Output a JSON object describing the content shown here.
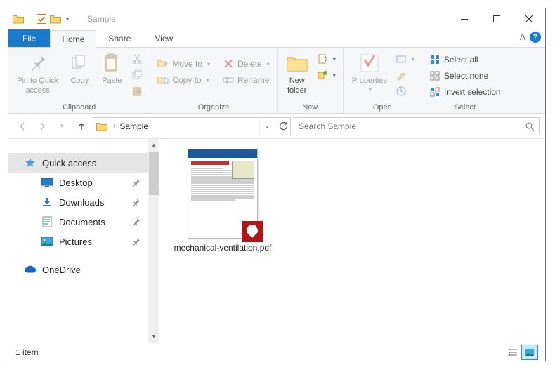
{
  "window": {
    "title": "Sample"
  },
  "tabs": {
    "file": "File",
    "home": "Home",
    "share": "Share",
    "view": "View"
  },
  "ribbon": {
    "clipboard": {
      "label": "Clipboard",
      "pin": "Pin to Quick\naccess",
      "copy": "Copy",
      "paste": "Paste"
    },
    "organize": {
      "label": "Organize",
      "moveto": "Move to",
      "copyto": "Copy to",
      "delete": "Delete",
      "rename": "Rename"
    },
    "new": {
      "label": "New",
      "newfolder": "New\nfolder"
    },
    "open": {
      "label": "Open",
      "properties": "Properties"
    },
    "select": {
      "label": "Select",
      "selectall": "Select all",
      "selectnone": "Select none",
      "invert": "Invert selection"
    }
  },
  "address": {
    "segment": "Sample"
  },
  "search": {
    "placeholder": "Search Sample"
  },
  "nav": {
    "quickaccess": "Quick access",
    "desktop": "Desktop",
    "downloads": "Downloads",
    "documents": "Documents",
    "pictures": "Pictures",
    "onedrive": "OneDrive"
  },
  "files": [
    {
      "name": "mechanical-ventilation.pdf"
    }
  ],
  "status": {
    "count": "1 item"
  }
}
